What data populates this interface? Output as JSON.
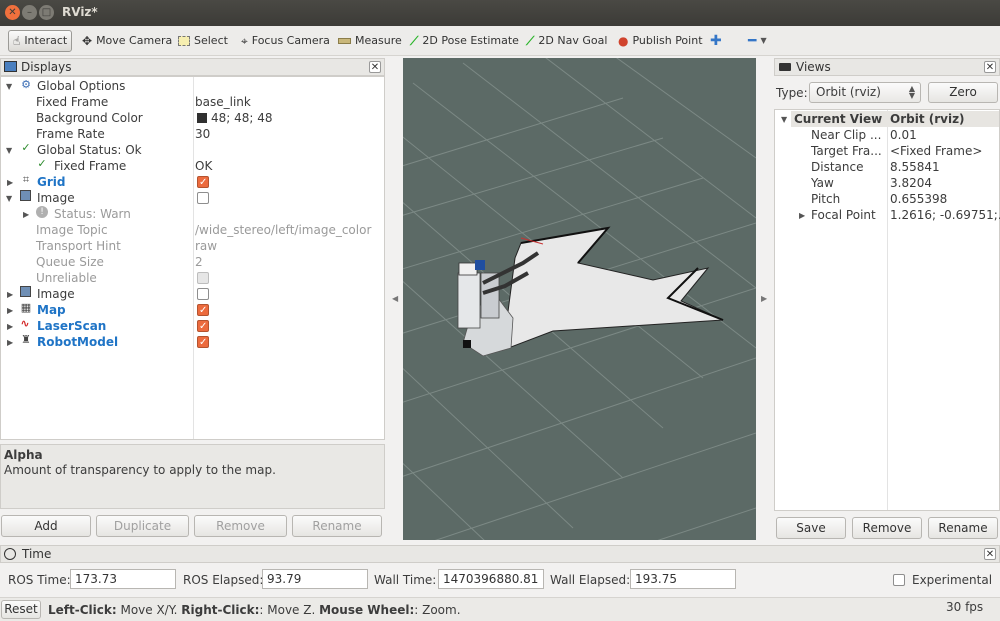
{
  "window": {
    "title": "RViz*"
  },
  "toolbar": {
    "interact": "Interact",
    "move_camera": "Move Camera",
    "select": "Select",
    "focus_camera": "Focus Camera",
    "measure": "Measure",
    "pose_estimate": "2D Pose Estimate",
    "nav_goal": "2D Nav Goal",
    "publish_point": "Publish Point"
  },
  "displays": {
    "title": "Displays",
    "rows": {
      "global_options": "Global Options",
      "fixed_frame": "Fixed Frame",
      "fixed_frame_val": "base_link",
      "background_color": "Background Color",
      "background_color_val": "48; 48; 48",
      "frame_rate": "Frame Rate",
      "frame_rate_val": "30",
      "global_status": "Global Status: Ok",
      "status_fixed_frame": "Fixed Frame",
      "status_fixed_frame_val": "OK",
      "grid": "Grid",
      "image1": "Image",
      "image1_status": "Status: Warn",
      "image_topic": "Image Topic",
      "image_topic_val": "/wide_stereo/left/image_color",
      "transport_hint": "Transport Hint",
      "transport_hint_val": "raw",
      "queue_size": "Queue Size",
      "queue_size_val": "2",
      "unreliable": "Unreliable",
      "image2": "Image",
      "map": "Map",
      "laserscan": "LaserScan",
      "robotmodel": "RobotModel"
    },
    "help_title": "Alpha",
    "help_text": "Amount of transparency to apply to the map.",
    "buttons": {
      "add": "Add",
      "duplicate": "Duplicate",
      "remove": "Remove",
      "rename": "Rename"
    }
  },
  "views": {
    "title": "Views",
    "type_label": "Type:",
    "type_value": "Orbit (rviz)",
    "zero": "Zero",
    "current_view": "Current View",
    "current_view_val": "Orbit (rviz)",
    "props": [
      {
        "name": "Near Clip ...",
        "value": "0.01"
      },
      {
        "name": "Target Fra...",
        "value": "<Fixed Frame>"
      },
      {
        "name": "Distance",
        "value": "8.55841"
      },
      {
        "name": "Yaw",
        "value": "3.8204"
      },
      {
        "name": "Pitch",
        "value": "0.655398"
      },
      {
        "name": "Focal Point",
        "value": "1.2616; -0.69751;..."
      }
    ],
    "buttons": {
      "save": "Save",
      "remove": "Remove",
      "rename": "Rename"
    }
  },
  "time": {
    "title": "Time",
    "ros_time_label": "ROS Time:",
    "ros_time": "173.73",
    "ros_elapsed_label": "ROS Elapsed:",
    "ros_elapsed": "93.79",
    "wall_time_label": "Wall Time:",
    "wall_time": "1470396880.81",
    "wall_elapsed_label": "Wall Elapsed:",
    "wall_elapsed": "193.75",
    "experimental": "Experimental"
  },
  "status": {
    "reset": "Reset",
    "left_click": "Left-Click:",
    "left_click_action": " Move X/Y. ",
    "right_click": "Right-Click:",
    "right_click_action": ": Move Z. ",
    "mouse_wheel": "Mouse Wheel:",
    "mouse_wheel_action": ": Zoom.",
    "fps": "30 fps"
  },
  "colors": {
    "viewport_bg": "#5c6a66",
    "accent_check": "#ec6b3e",
    "link_blue": "#1f74c6"
  }
}
